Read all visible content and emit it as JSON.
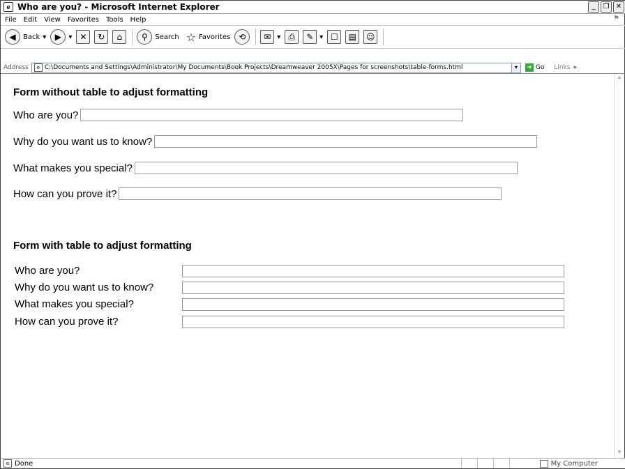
{
  "window": {
    "title": "Who are you? - Microsoft Internet Explorer"
  },
  "menu": [
    "File",
    "Edit",
    "View",
    "Favorites",
    "Tools",
    "Help"
  ],
  "toolbar": {
    "back_label": "Back",
    "search_label": "Search",
    "favorites_label": "Favorites"
  },
  "address": {
    "label": "Address",
    "url": "C:\\Documents and Settings\\Administrator\\My Documents\\Book Projects\\Dreamweaver 2005X\\Pages for screenshots\\table-forms.html",
    "go_label": "Go",
    "links_label": "Links"
  },
  "page": {
    "section1_title": "Form without table to adjust formatting",
    "section2_title": "Form with table to adjust formatting",
    "questions": [
      "Who are you?",
      "Why do you want us to know?",
      "What makes you special?",
      "How can you prove it?"
    ]
  },
  "status": {
    "text": "Done",
    "zone": "My Computer"
  }
}
